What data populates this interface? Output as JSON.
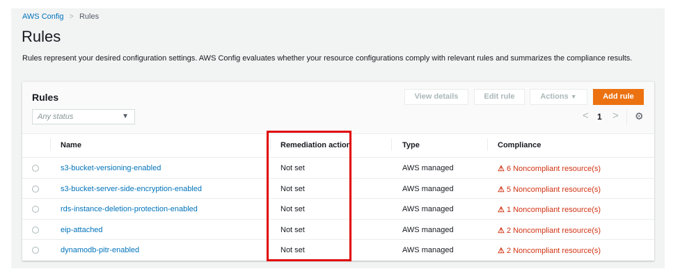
{
  "breadcrumb": {
    "parent": "AWS Config",
    "current": "Rules"
  },
  "page_title": "Rules",
  "description": "Rules represent your desired configuration settings. AWS Config evaluates whether your resource configurations comply with relevant rules and summarizes the compliance results.",
  "card": {
    "title": "Rules",
    "filter_placeholder": "Any status",
    "buttons": {
      "view_details": "View details",
      "edit_rule": "Edit rule",
      "actions": "Actions",
      "add_rule": "Add rule"
    },
    "page": "1"
  },
  "columns": {
    "name": "Name",
    "remediation": "Remediation action",
    "type": "Type",
    "compliance": "Compliance"
  },
  "rows": [
    {
      "name": "s3-bucket-versioning-enabled",
      "remediation": "Not set",
      "type": "AWS managed",
      "compliance": "6 Noncompliant resource(s)"
    },
    {
      "name": "s3-bucket-server-side-encryption-enabled",
      "remediation": "Not set",
      "type": "AWS managed",
      "compliance": "5 Noncompliant resource(s)"
    },
    {
      "name": "rds-instance-deletion-protection-enabled",
      "remediation": "Not set",
      "type": "AWS managed",
      "compliance": "1 Noncompliant resource(s)"
    },
    {
      "name": "eip-attached",
      "remediation": "Not set",
      "type": "AWS managed",
      "compliance": "2 Noncompliant resource(s)"
    },
    {
      "name": "dynamodb-pitr-enabled",
      "remediation": "Not set",
      "type": "AWS managed",
      "compliance": "2 Noncompliant resource(s)"
    }
  ],
  "colors": {
    "accent": "#ec7211",
    "link": "#0073bb",
    "error": "#d13212",
    "highlight": "#e00000"
  }
}
